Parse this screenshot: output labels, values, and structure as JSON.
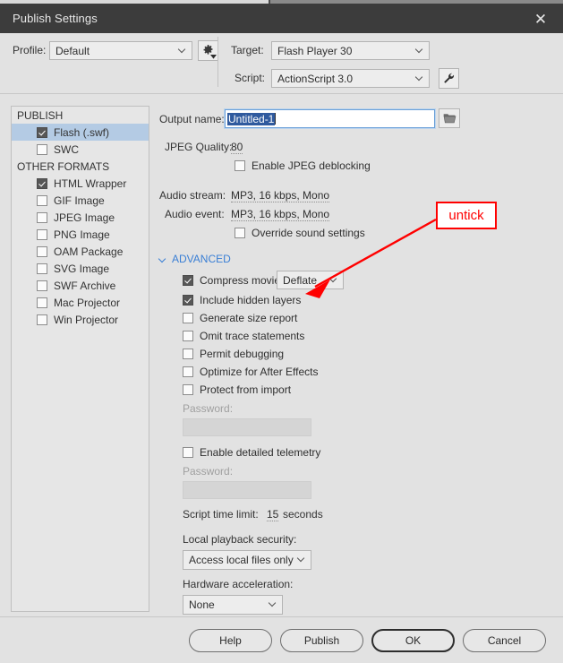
{
  "window": {
    "title": "Publish Settings",
    "close_icon": "close-icon"
  },
  "top": {
    "profile_label": "Profile:",
    "profile_value": "Default",
    "profile_options_icon": "gear-icon",
    "target_label": "Target:",
    "target_value": "Flash Player 30",
    "script_label": "Script:",
    "script_value": "ActionScript 3.0",
    "script_settings_icon": "wrench-icon"
  },
  "sidebar": {
    "groups": [
      {
        "title": "PUBLISH",
        "items": [
          {
            "label": "Flash (.swf)",
            "checked": true,
            "selected": true
          },
          {
            "label": "SWC",
            "checked": false,
            "selected": false
          }
        ]
      },
      {
        "title": "OTHER FORMATS",
        "items": [
          {
            "label": "HTML Wrapper",
            "checked": true,
            "selected": false
          },
          {
            "label": "GIF Image",
            "checked": false,
            "selected": false
          },
          {
            "label": "JPEG Image",
            "checked": false,
            "selected": false
          },
          {
            "label": "PNG Image",
            "checked": false,
            "selected": false
          },
          {
            "label": "OAM Package",
            "checked": false,
            "selected": false
          },
          {
            "label": "SVG Image",
            "checked": false,
            "selected": false
          },
          {
            "label": "SWF Archive",
            "checked": false,
            "selected": false
          },
          {
            "label": "Mac Projector",
            "checked": false,
            "selected": false
          },
          {
            "label": "Win Projector",
            "checked": false,
            "selected": false
          }
        ]
      }
    ]
  },
  "main": {
    "output_name_label": "Output name:",
    "output_name_value": "Untitled-1",
    "browse_icon": "folder-icon",
    "jpeg_quality_label": "JPEG Quality:",
    "jpeg_quality_value": "80",
    "jpeg_deblocking_label": "Enable JPEG deblocking",
    "jpeg_deblocking_checked": false,
    "audio_stream_label": "Audio stream:",
    "audio_stream_value": "MP3, 16 kbps, Mono",
    "audio_event_label": "Audio event:",
    "audio_event_value": "MP3, 16 kbps, Mono",
    "override_sound_label": "Override sound settings",
    "override_sound_checked": false,
    "advanced_label": "ADVANCED",
    "advanced_expanded": true,
    "compress_movie_label": "Compress movie",
    "compress_movie_checked": true,
    "compress_movie_value": "Deflate",
    "options": [
      {
        "label": "Include hidden layers",
        "checked": true
      },
      {
        "label": "Generate size report",
        "checked": false
      },
      {
        "label": "Omit trace statements",
        "checked": false
      },
      {
        "label": "Permit debugging",
        "checked": false
      },
      {
        "label": "Optimize for After Effects",
        "checked": false
      },
      {
        "label": "Protect from import",
        "checked": false
      }
    ],
    "password_label_1": "Password:",
    "password_value_1": "",
    "telemetry_label": "Enable detailed telemetry",
    "telemetry_checked": false,
    "password_label_2": "Password:",
    "password_value_2": "",
    "script_time_limit_label": "Script time limit:",
    "script_time_limit_value": "15",
    "script_time_limit_unit": "seconds",
    "local_playback_label": "Local playback security:",
    "local_playback_value": "Access local files only",
    "hardware_accel_label": "Hardware acceleration:",
    "hardware_accel_value": "None"
  },
  "footer": {
    "help": "Help",
    "publish": "Publish",
    "ok": "OK",
    "cancel": "Cancel"
  },
  "annotation": {
    "callout_text": "untick",
    "color": "#ff0000"
  }
}
